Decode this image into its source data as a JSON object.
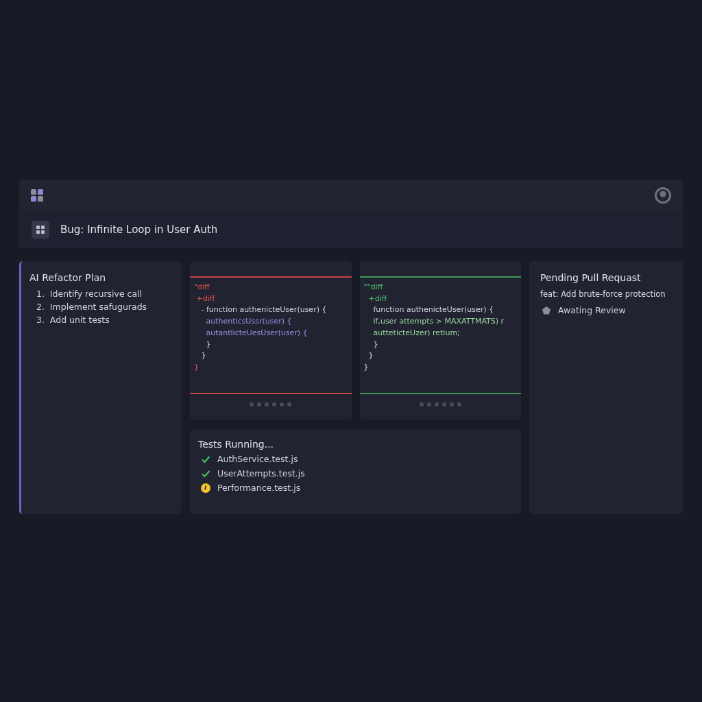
{
  "issue": {
    "title": "Bug: Infinite Loop in User Auth"
  },
  "plan": {
    "title": "AI Refactor Plan",
    "steps": [
      {
        "number": "1.",
        "text": "Identify recursive call"
      },
      {
        "number": "2.",
        "text": "Implement safugurads"
      },
      {
        "number": "3.",
        "text": "Add unit tests"
      }
    ]
  },
  "diffs": [
    {
      "kind": "removed",
      "lines": [
        {
          "kind": "marker",
          "text": "\"diff"
        },
        {
          "kind": "marker",
          "text": " +diff"
        },
        {
          "kind": "code",
          "text": "   - function authenicteUser(user) {"
        },
        {
          "kind": "accent",
          "text": "     authenticsUssr(user) {"
        },
        {
          "kind": "accent",
          "text": "     autantlicteUesUser(user) {"
        },
        {
          "kind": "code",
          "text": "     }"
        },
        {
          "kind": "code",
          "text": "   }"
        },
        {
          "kind": "marker",
          "text": "}"
        }
      ]
    },
    {
      "kind": "added",
      "lines": [
        {
          "kind": "marker",
          "text": "\"\"diff"
        },
        {
          "kind": "marker",
          "text": "  +diff"
        },
        {
          "kind": "code",
          "text": "    function authenicteUser(user) {"
        },
        {
          "kind": "accent",
          "text": "    if,user attempts > MAXATTMATS) r"
        },
        {
          "kind": "accent",
          "text": "    autteticteUzer) retium;"
        },
        {
          "kind": "code",
          "text": "    }"
        },
        {
          "kind": "code",
          "text": "  }"
        },
        {
          "kind": "code",
          "text": "}"
        }
      ]
    }
  ],
  "tests": {
    "title": "Tests Running...",
    "items": [
      {
        "name": "AuthService.test.js",
        "kind": "passed"
      },
      {
        "name": "UserAttempts.test.js",
        "kind": "passed"
      },
      {
        "name": "Performance.test.js",
        "kind": "running"
      }
    ]
  },
  "pull_request": {
    "title": "Pending Pull Requast",
    "commit": "feat: Add brute-force protection",
    "status": "Awating Review"
  }
}
